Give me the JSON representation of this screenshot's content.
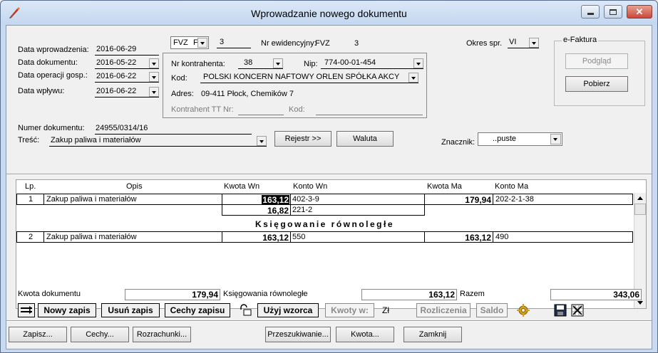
{
  "window": {
    "title": "Wprowadzanie nowego dokumentu"
  },
  "header": {
    "data_wprowadzenia_label": "Data wprowadzenia:",
    "data_wprowadzenia": "2016-06-29",
    "data_dokumentu_label": "Data dokumentu:",
    "data_dokumentu": "2016-05-22",
    "data_operacji_label": "Data operacji gosp.:",
    "data_operacji": "2016-06-22",
    "data_wplywu_label": "Data wpływu:",
    "data_wplywu": "2016-06-22",
    "doc_type": "FVZ",
    "doc_type_suffix": "F",
    "doc_number": "3",
    "nr_ewidencyjny_label": "Nr ewidencyjny:",
    "nr_ewidencyjny_value": "FVZ",
    "nr_ewidencyjny_num": "3",
    "okres_label": "Okres spr.",
    "okres_value": "VI",
    "numer_dokumentu_label": "Numer dokumentu:",
    "numer_dokumentu": "24955/0314/16",
    "tresc_label": "Treść:",
    "tresc": "Zakup paliwa i materiałów",
    "znacznik_label": "Znacznik:",
    "znacznik": "..puste"
  },
  "kontrahent": {
    "nr_label": "Nr kontrahenta:",
    "nr": "38",
    "nip_label": "Nip:",
    "nip": "774-00-01-454",
    "kod_label": "Kod:",
    "kod": "POLSKI KONCERN NAFTOWY ORLEN SPÓŁKA AKCY",
    "adres_label": "Adres:",
    "adres": "09-411 Płock, Chemików 7",
    "tt_label": "Kontrahent TT Nr:",
    "tt_kod_label": "Kod:"
  },
  "efaktura": {
    "title": "e-Faktura",
    "podglad": "Podgląd",
    "pobierz": "Pobierz"
  },
  "mid_buttons": {
    "rejestr": "Rejestr >>",
    "waluta": "Waluta"
  },
  "grid": {
    "headers": {
      "lp": "Lp.",
      "opis": "Opis",
      "kwota_wn": "Kwota Wn",
      "konto_wn": "Konto Wn",
      "kwota_ma": "Kwota Ma",
      "konto_ma": "Konto Ma"
    },
    "row1": {
      "lp": "1",
      "opis": "Zakup paliwa i materiałów",
      "kwota_wn": "163,12",
      "konto_wn": "402-3-9",
      "kwota_ma": "179,94",
      "konto_ma": "202-2-1-38"
    },
    "row1b": {
      "kwota_wn": "16,82",
      "konto_wn": "221-2"
    },
    "parallel_title": "Księgowanie równoległe",
    "row2": {
      "lp": "2",
      "opis": "Zakup paliwa i materiałów",
      "kwota_wn": "163,12",
      "konto_wn": "550",
      "kwota_ma": "163,12",
      "konto_ma": "490"
    }
  },
  "totals": {
    "kwota_dokumentu_label": "Kwota dokumentu",
    "kwota_dokumentu": "179,94",
    "ksiegowania_label": "Księgowania równoległe",
    "ksiegowania": "163,12",
    "razem_label": "Razem",
    "razem": "343,06"
  },
  "toolbar": {
    "nowy_zapis": "Nowy zapis",
    "usun_zapis": "Usuń zapis",
    "cechy_zapisu": "Cechy zapisu",
    "uzyj_wzorca": "Użyj wzorca",
    "kwoty_w": "Kwoty w:",
    "currency": "Zł",
    "rozliczenia": "Rozliczenia",
    "saldo": "Saldo"
  },
  "footer": {
    "zapisz": "Zapisz...",
    "cechy": "Cechy...",
    "rozrachunki": "Rozrachunki...",
    "przeszukiwanie": "Przeszukiwanie...",
    "kwota": "Kwota...",
    "zamknij": "Zamknij"
  },
  "colors": {
    "title_bg": "#c4d7ef",
    "client_bg": "#f0f0f0",
    "selection": "#000000"
  }
}
